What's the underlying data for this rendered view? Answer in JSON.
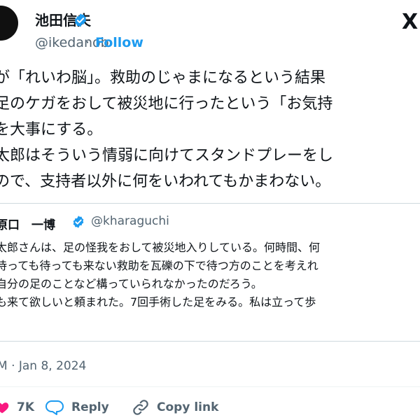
{
  "author": {
    "name": "池田信夫",
    "handle": "@ikedanob",
    "separator": "·",
    "follow_label": "Follow"
  },
  "logo": "X",
  "tweet": {
    "lines": [
      "が「れいわ脳」。救助のじゃまになるという結果",
      "足のケガをおして被災地に行ったという「お気持",
      "を大事にする。",
      "太郎はそういう情弱に向けてスタンドプレーをし",
      "ので、支持者以外に何をいわれてもかまわない。"
    ]
  },
  "quote": {
    "name": "原口　一博",
    "handle": "@kharaguchi",
    "lines": [
      "太郎さんは、足の怪我をおして被災地入りしている。何時間、何",
      "待っても待っても来ない救助を瓦礫の下で待つ方のことを考えれ",
      "自分の足のことなど構っていられなかったのだろう。",
      "も来て欲しいと頼まれた。7回手術した足をみる。私は立って歩"
    ]
  },
  "timestamp": "M · Jan 8, 2024",
  "actions": {
    "likes_count": "7K",
    "reply_label": "Reply",
    "copy_label": "Copy link"
  },
  "colors": {
    "accent": "#1d9bf0",
    "like": "#f91880",
    "secondary_text": "#536471",
    "border": "#cfd9de"
  }
}
